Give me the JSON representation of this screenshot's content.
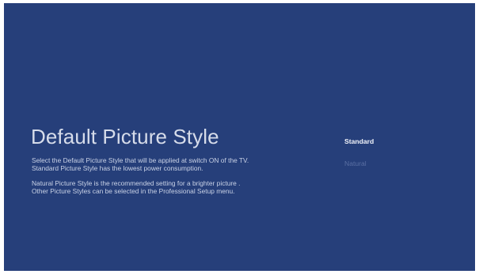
{
  "screen": {
    "title": "Default Picture Style",
    "description": {
      "paragraph1": {
        "line1": "Select the Default Picture Style that will be applied at switch ON of the TV.",
        "line2": "Standard Picture Style has the lowest power consumption."
      },
      "paragraph2": {
        "line1": "Natural Picture Style is the recommended setting for a brighter picture .",
        "line2": "Other Picture Styles can be selected in the Professional Setup menu."
      }
    },
    "options": [
      {
        "label": "Standard",
        "selected": true
      },
      {
        "label": "Natural",
        "selected": false
      }
    ]
  },
  "colors": {
    "background": "#263f7a",
    "title_text": "#d6dcea",
    "selected_option": "#f2f4fa",
    "unselected_option": "#5a6fa3"
  }
}
